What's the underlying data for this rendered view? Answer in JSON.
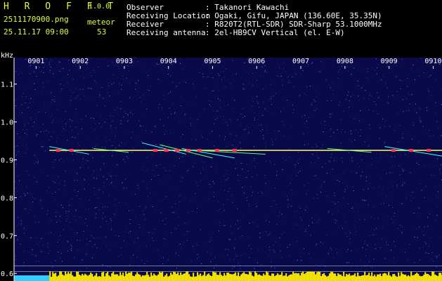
{
  "header": {
    "brand": "H R O F F T",
    "version": "1.0.0",
    "filename": "2511170900.png",
    "datetime": "25.11.17 09:00",
    "count_label": "meteor",
    "count_value": "53",
    "info": [
      {
        "label": "Observer",
        "value": ": Takanori Kawachi"
      },
      {
        "label": "Receiving Location",
        "value": ": Ogaki, Gifu, JAPAN (136.60E, 35.35N)"
      },
      {
        "label": "Receiver",
        "value": ": R820T2(RTL-SDR) SDR-Sharp 53.1000MHz"
      },
      {
        "label": "Receiving antenna",
        "value": ": 2el-HB9CV Vertical (el. E-W)"
      }
    ]
  },
  "colors": {
    "header_text": "#d8ff3c",
    "info_text": "#ffffff",
    "plot_bg": "#0a0a4a",
    "carrier": "#ffff66",
    "hot": "#ff3355",
    "cyan": "#44ffee",
    "green": "#66ff66",
    "bottom_band": "#ffee00",
    "bottom_cyan": "#33ccff"
  },
  "chart_data": {
    "type": "heatmap",
    "ylabel": "kHz",
    "x_ticks": [
      "0901",
      "0902",
      "0903",
      "0904",
      "0905",
      "0906",
      "0907",
      "0908",
      "0909",
      "0910"
    ],
    "y_ticks": [
      "1.1",
      "1.0",
      "0.9",
      "0.8",
      "0.7",
      "0.6"
    ],
    "y_tick_values": [
      1.1,
      1.0,
      0.9,
      0.8,
      0.7,
      0.6
    ],
    "ylim": [
      0.58,
      1.17
    ],
    "xlim": [
      0.5,
      10.2
    ],
    "carrier_khz": 0.925,
    "carrier_x_range": [
      1.3,
      10.2
    ]
  }
}
